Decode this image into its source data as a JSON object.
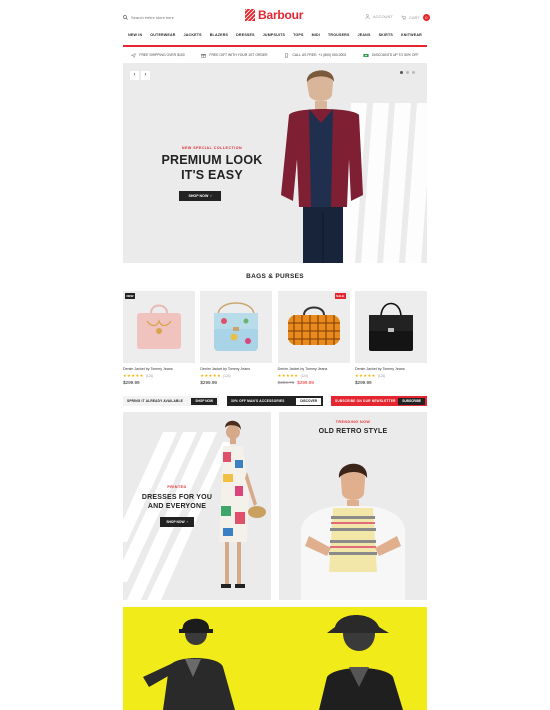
{
  "brand": {
    "name": "Barbour",
    "accent": "#e3262f"
  },
  "header": {
    "search_placeholder": "Search entire store here",
    "account_label": "ACCOUNT",
    "cart_label": "CART",
    "cart_count": "0"
  },
  "nav": [
    "NEW IN",
    "OUTERWEAR",
    "JACKETS",
    "BLAZERS",
    "DRESSES",
    "JUMPSUITS",
    "TOPS",
    "MIDI",
    "TROUSERS",
    "JEANS",
    "SKIRTS",
    "KNITWEAR"
  ],
  "perks": [
    {
      "icon": "plane-icon",
      "text": "FREE SHIPPING OVER $100"
    },
    {
      "icon": "gift-icon",
      "text": "FREE GIFT WITH YOUR 1ST ORDER"
    },
    {
      "icon": "phone-icon",
      "text": "CALL US FREE: +1 (800) 000-0002"
    },
    {
      "icon": "money-icon",
      "text": "DISCOUNTS UP TO 50% OFF"
    }
  ],
  "hero": {
    "eyebrow": "NEW SPECIAL COLLECTION",
    "title_line1": "PREMIUM LOOK",
    "title_line2": "IT'S EASY",
    "button": "SHOP NOW",
    "prev_icon": "‹",
    "next_icon": "›",
    "slides": 3,
    "active_slide": 1
  },
  "section": {
    "title": "BAGS & PURSES"
  },
  "products": [
    {
      "badge": "NEW",
      "name": "Denim Jacket by Tommy Jeans",
      "stars": "★★★★★",
      "reviews": "(124)",
      "price": "$299.99",
      "old_price": ""
    },
    {
      "badge": "",
      "name": "Denim Jacket by Tommy Jeans",
      "stars": "★★★★★",
      "reviews": "(124)",
      "price": "$299.99",
      "old_price": ""
    },
    {
      "badge": "SALE",
      "name": "Denim Jacket by Tommy Jeans",
      "stars": "★★★★★",
      "reviews": "(124)",
      "price": "$299.99",
      "old_price": "$336.76"
    },
    {
      "badge": "",
      "name": "Denim Jacket by Tommy Jeans",
      "stars": "★★★★★",
      "reviews": "(124)",
      "price": "$299.99",
      "old_price": ""
    }
  ],
  "promos": [
    {
      "text": "SPRING IT ALREADY AVAILABLE",
      "button": "SHOP NOW"
    },
    {
      "text": "30% OFF MAN'S ACCESSORIES",
      "button": "DISCOVER"
    },
    {
      "text": "SUBSCRIBE ON OUR NEWSLETTER",
      "button": "SUBSCRIBE"
    }
  ],
  "banner_left": {
    "eyebrow": "PRINTED",
    "title_line1": "DRESSES FOR YOU",
    "title_line2": "AND EVERYONE",
    "button": "SHOP NOW"
  },
  "banner_right": {
    "eyebrow": "TRENDING NOW",
    "title": "OLD RETRO STYLE"
  }
}
